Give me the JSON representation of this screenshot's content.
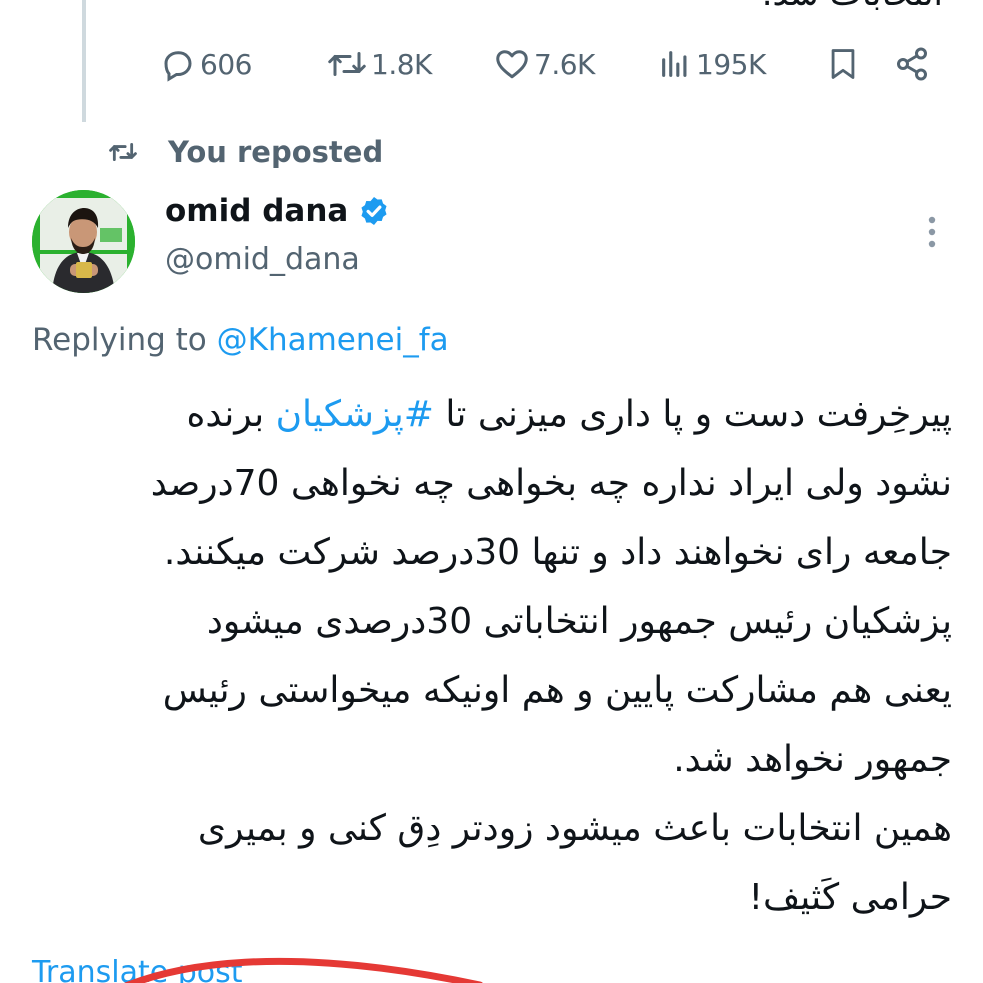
{
  "top_clip_text": "انتخابات شد.",
  "actions": {
    "replies": "606",
    "reposts": "1.8K",
    "likes": "7.6K",
    "views": "195K"
  },
  "repost_banner": {
    "label": "You reposted"
  },
  "author": {
    "display_name": "omid dana",
    "handle": "@omid_dana",
    "verified": true
  },
  "reply_context": {
    "prefix": "Replying to ",
    "mention": "@Khamenei_fa"
  },
  "tweet": {
    "line1_before": "پیرخِرفت دست و پا داری میزنی تا ",
    "hashtag": "#پزشکیان",
    "line1_after": " برنده",
    "line2": "نشود ولی ایراد نداره چه بخواهی چه نخواهی 70درصد",
    "line3": "جامعه رای نخواهند داد و تنها 30درصد شرکت میکنند.",
    "line4": "پزشکیان رئیس جمهور انتخاباتی 30درصدی میشود",
    "line5": "یعنی هم مشارکت پایین و هم اونیکه میخواستی رئیس",
    "line6": "جمهور نخواهد شد.",
    "line7": "همین انتخابات باعث میشود زودتر دِق کنی و بمیری",
    "line8": "حرامی کَثیف!"
  },
  "translate_link": "Translate post",
  "colors": {
    "accent": "#1d9bf0",
    "secondary_text": "#536471",
    "primary_text": "#0f1419",
    "avatar_bg": "#2bb12f",
    "annotation_stroke": "#e53935"
  },
  "icons": {
    "reply": "speech-bubble-icon",
    "repost": "repost-arrows-icon",
    "like": "heart-icon",
    "views": "bar-chart-icon",
    "bookmark": "bookmark-icon",
    "share": "share-icon",
    "verified": "verified-badge-icon",
    "more": "more-vertical-icon"
  }
}
